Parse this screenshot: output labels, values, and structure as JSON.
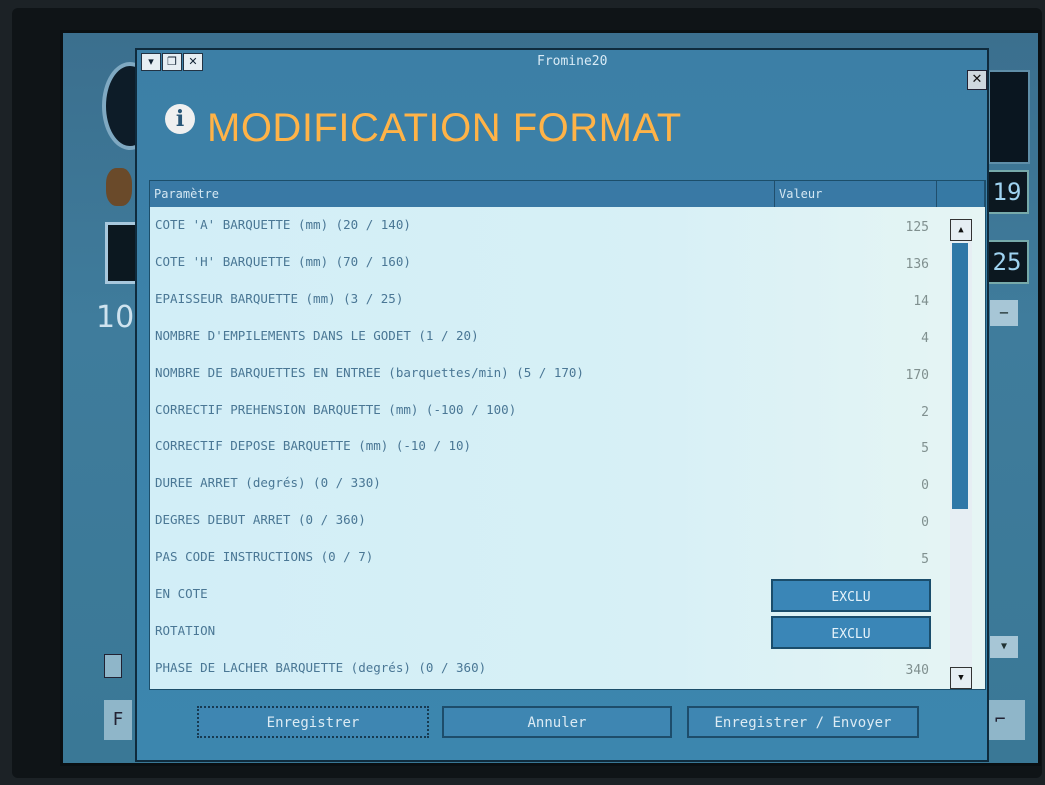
{
  "window": {
    "title": "Fromine20"
  },
  "header": {
    "title": "MODIFICATION FORMAT",
    "icon": "info-icon"
  },
  "table": {
    "col_param": "Paramètre",
    "col_value": "Valeur",
    "rows": [
      {
        "label": "COTE 'A' BARQUETTE (mm) (20 / 140)",
        "value": "125"
      },
      {
        "label": "COTE 'H' BARQUETTE (mm) (70 / 160)",
        "value": "136"
      },
      {
        "label": "EPAISSEUR BARQUETTE (mm) (3 / 25)",
        "value": "14"
      },
      {
        "label": "NOMBRE D'EMPILEMENTS DANS LE GODET (1 / 20)",
        "value": "4"
      },
      {
        "label": "NOMBRE DE BARQUETTES EN ENTREE (barquettes/min) (5 / 170)",
        "value": "170"
      },
      {
        "label": "CORRECTIF PREHENSION BARQUETTE (mm) (-100 / 100)",
        "value": "2"
      },
      {
        "label": "CORRECTIF DEPOSE BARQUETTE (mm) (-10 / 10)",
        "value": "5"
      },
      {
        "label": "DUREE ARRET (degrés) (0 / 330)",
        "value": "0"
      },
      {
        "label": "DEGRES DEBUT ARRET (0 / 360)",
        "value": "0"
      },
      {
        "label": "PAS CODE INSTRUCTIONS (0 / 7)",
        "value": "5"
      },
      {
        "label": "EN COTE",
        "button": "EXCLU"
      },
      {
        "label": "ROTATION",
        "button": "EXCLU"
      },
      {
        "label": "PHASE DE LACHER BARQUETTE (degrés) (0 / 360)",
        "value": "340"
      }
    ]
  },
  "buttons": {
    "save": "Enregistrer",
    "cancel": "Annuler",
    "save_send": "Enregistrer / Envoyer"
  },
  "background": {
    "left_number": "10",
    "left_key": "F",
    "right_num1": "19",
    "right_num2": "25"
  }
}
